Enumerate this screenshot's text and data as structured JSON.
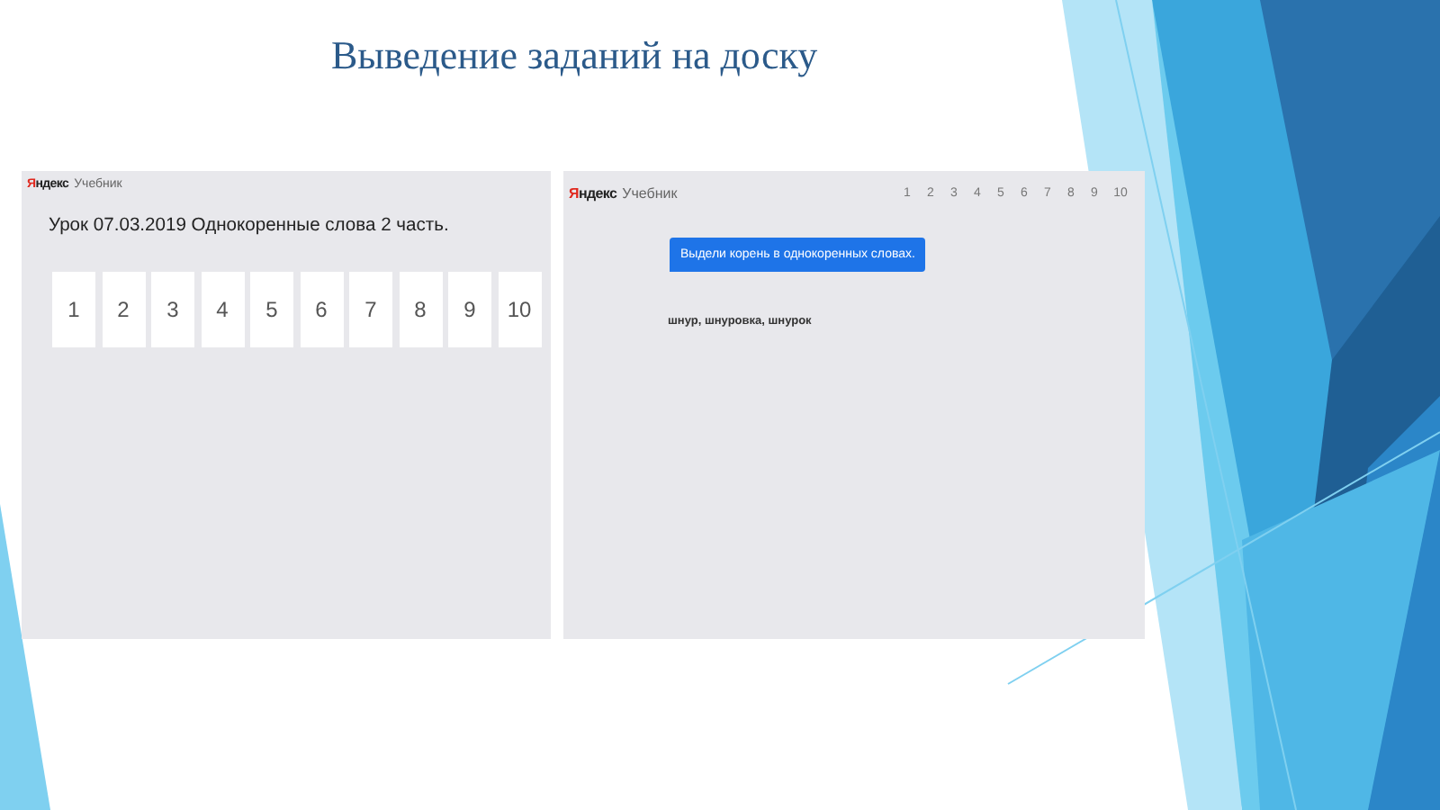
{
  "slide": {
    "title": "Выведение заданий на доску"
  },
  "left_screen": {
    "logo": {
      "brand": "Яндекс",
      "product": "Учебник"
    },
    "lesson_title": "Урок 07.03.2019 Однокоренные слова 2 часть.",
    "task_cards": [
      "1",
      "2",
      "3",
      "4",
      "5",
      "6",
      "7",
      "8",
      "9",
      "10"
    ]
  },
  "right_screen": {
    "logo": {
      "brand": "Яндекс",
      "product": "Учебник"
    },
    "task_numbers": [
      "1",
      "2",
      "3",
      "4",
      "5",
      "6",
      "7",
      "8",
      "9",
      "10"
    ],
    "instruction": "Выдели корень в однокоренных словах.",
    "words": "шнур, шнуровка, шнурок"
  }
}
